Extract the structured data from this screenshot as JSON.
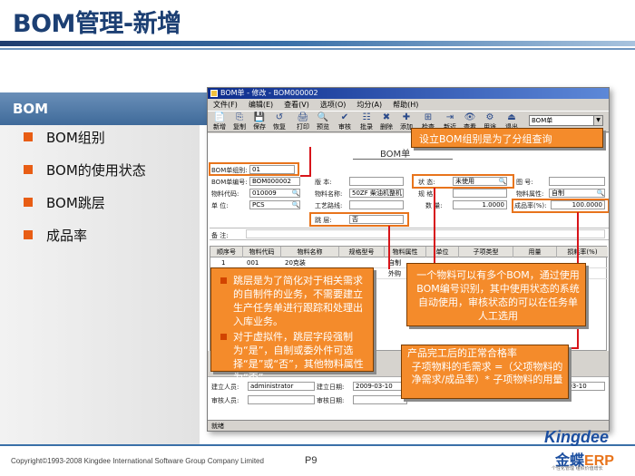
{
  "slide": {
    "title": "BOM管理-新增",
    "left_header": "BOM",
    "bullets": [
      "BOM组别",
      "BOM的使用状态",
      "BOM跳层",
      "成品率"
    ],
    "copyright": "Copyright©1993-2008 Kingdee International Software Group Company Limited",
    "page": "P9",
    "logo_en": "Kingdee",
    "logo_cn": "金蝶",
    "logo_erp": "ERP",
    "logo_sub": "个性化管理 组织价值增长"
  },
  "window": {
    "title": "BOM单 - 修改 - BOM000002",
    "menu": [
      "文件(F)",
      "编辑(E)",
      "查看(V)",
      "选项(O)",
      "均分(A)",
      "帮助(H)"
    ],
    "toolbar": [
      "新增",
      "复制",
      "保存",
      "恢复",
      "打印",
      "预览",
      "审核",
      "批录",
      "删除",
      "添加",
      "检查",
      "新近",
      "查看",
      "用途",
      "退出"
    ],
    "toolbar_icons": [
      "📄",
      "⎘",
      "💾",
      "↺",
      "🖨",
      "🔍",
      "✔",
      "☷",
      "✖",
      "✚",
      "⊞",
      "⇥",
      "👁",
      "⚙",
      "⏏"
    ],
    "selector_value": "BOM单",
    "form_title": "BOM单",
    "fields": {
      "group_label": "BOM单组别:",
      "group_value": "01",
      "code_label": "BOM单编号:",
      "code_value": "BOM000002",
      "version_label": "版  本:",
      "version_value": "",
      "status_label": "状  态:",
      "status_value": "未使用",
      "figno_label": "图  号:",
      "figno_value": "",
      "material_code_label": "物料代码:",
      "material_code_value": "010009",
      "material_name_label": "物料名称:",
      "material_name_value": "50ZF 柴油机整机",
      "spec_label": "规  格:",
      "spec_value": "",
      "attr_label": "物料属性:",
      "attr_value": "自制",
      "unit_label": "单  位:",
      "unit_value": "PCS",
      "route_label": "工艺路线:",
      "route_value": "",
      "qty_label": "数  量:",
      "qty_value": "1.0000",
      "yield_label": "成品率(%):",
      "yield_value": "100.0000",
      "skip_label": "跳  层:",
      "skip_value": "否",
      "remark_label": "备  注:"
    },
    "grid": {
      "headers": [
        "顺序号",
        "物料代码",
        "物料名称",
        "规格型号",
        "物料属性",
        "单位",
        "子项类型",
        "用量",
        "损耗率(%)"
      ],
      "rows": [
        [
          "1",
          "001",
          "20克装",
          "",
          "自制",
          "",
          "",
          "",
          ""
        ],
        [
          "2",
          "",
          "",
          "",
          "外购",
          "",
          "",
          "",
          ""
        ]
      ]
    },
    "footer": {
      "creator_label": "建立人员:",
      "creator_value": "administrator",
      "created_label": "建立日期:",
      "created_value": "2009-03-10",
      "modified_value": "2009-03-10",
      "auditor_label": "审核人员:",
      "audit_date_label": "审核日期:"
    },
    "status_text": "就绪"
  },
  "callouts": {
    "group": "设立BOM组别是为了分组查询",
    "skip_items": [
      "跳层是为了简化对于相关需求的自制件的业务，不需要建立生产任务单进行跟踪和处理出入库业务。",
      "对于虚拟件，跳层字段强制为“是”，自制或委外件可选择“是”或“否”，其他物料属性为“否”。"
    ],
    "status": "一个物料可以有多个BOM，通过使用BOM编号识别，其中使用状态的系统自动使用，审核状态的可以在任务单人工选用",
    "yield_line1": "产品完工后的正常合格率",
    "yield_line2": "子项物料的毛需求 =（父项物料的净需求/成品率）* 子项物料的用量"
  },
  "colors": {
    "title": "#1c3f73",
    "accent": "#e8741c",
    "callout_fill": "#f48b2b",
    "leader_line": "#d7141a"
  }
}
